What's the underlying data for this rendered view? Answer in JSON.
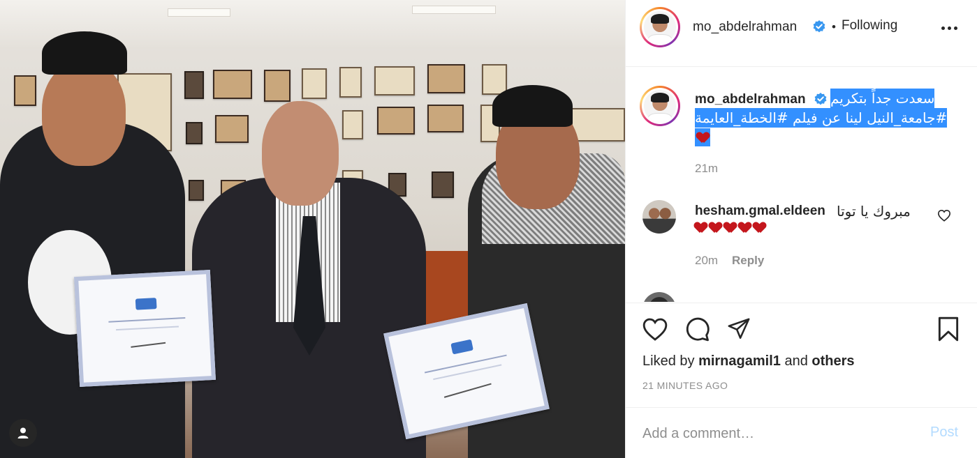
{
  "post": {
    "author": "mo_abdelrahman",
    "separator": "•",
    "follow_status": "Following",
    "caption_line1": "سعدت جداً بتكريم",
    "caption_line2": "#جامعة_النيل لينا عن فيلم #الخطة_العايمة",
    "caption_time": "21m"
  },
  "comments": [
    {
      "user": "hesham.gmal.eldeen",
      "text": "مبروك يا توتا",
      "time": "20m",
      "reply_label": "Reply"
    }
  ],
  "likes": {
    "prefix": "Liked by",
    "user": "mirnagamil1",
    "joiner": "and",
    "others": "others"
  },
  "timestamp": "21 MINUTES AGO",
  "add_comment": {
    "placeholder": "Add a comment…",
    "post_label": "Post"
  },
  "colors": {
    "verified": "#3897f0",
    "selection": "#3390ff",
    "heart_emoji": "#c4161c",
    "post_disabled": "#b3dbff"
  },
  "icons": {
    "like": "heart-outline-icon",
    "comment": "speech-bubble-icon",
    "share": "paper-plane-icon",
    "save": "bookmark-icon",
    "more": "more-options-icon",
    "verified": "verified-badge-icon",
    "tag": "user-tag-icon"
  }
}
